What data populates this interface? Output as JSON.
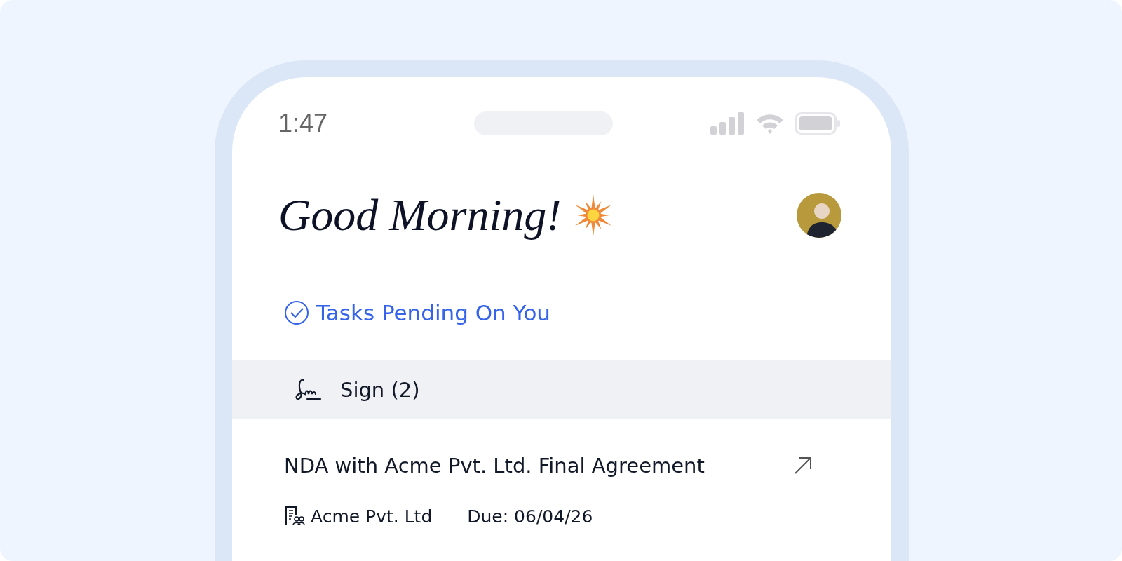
{
  "status_bar": {
    "time": "1:47"
  },
  "greeting": "Good Morning!",
  "section": {
    "title": "Tasks Pending On You"
  },
  "group": {
    "label": "Sign (2)"
  },
  "tasks": [
    {
      "title": "NDA with Acme Pvt. Ltd. Final Agreement",
      "company": "Acme Pvt. Ltd",
      "due": "Due: 06/04/26"
    }
  ]
}
